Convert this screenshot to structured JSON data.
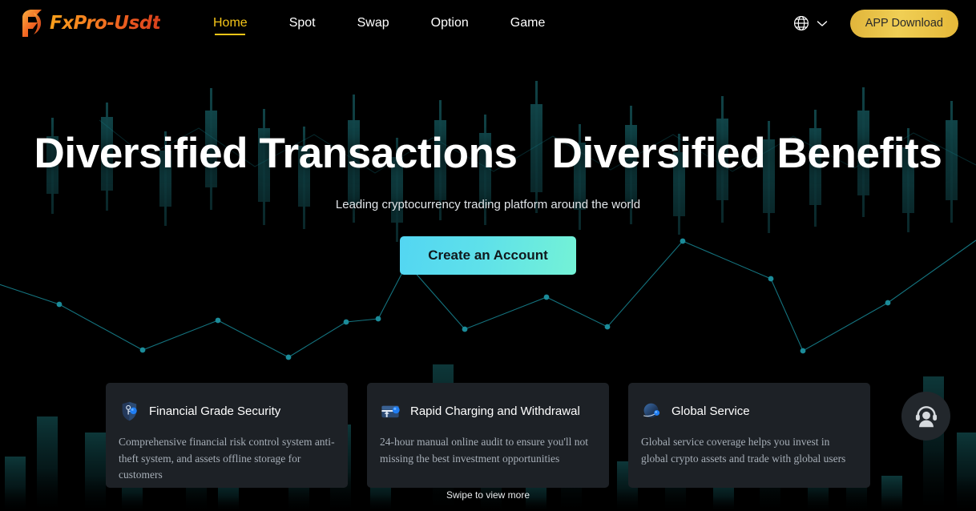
{
  "brand": {
    "logo_text": "FxPro-Usdt",
    "logo_icon": "flame-f-logo-icon"
  },
  "header": {
    "nav": [
      {
        "label": "Home",
        "active": true
      },
      {
        "label": "Spot",
        "active": false
      },
      {
        "label": "Swap",
        "active": false
      },
      {
        "label": "Option",
        "active": false
      },
      {
        "label": "Game",
        "active": false
      }
    ],
    "language_icon": "globe-icon",
    "language_chevron_icon": "chevron-down-icon",
    "app_download_label": "APP Download"
  },
  "hero": {
    "title": "Diversified Transactions   Diversified Benefits",
    "subtitle": "Leading cryptocurrency trading platform around the world",
    "cta_label": "Create an Account"
  },
  "cards": [
    {
      "icon": "shield-key-icon",
      "title": "Financial Grade Security",
      "desc": "Comprehensive financial risk control system anti-theft system, and assets offline storage for customers"
    },
    {
      "icon": "wallet-arrow-up-icon",
      "title": "Rapid Charging and Withdrawal",
      "desc": "24-hour manual online audit to ensure you'll not missing the best investment opportunities"
    },
    {
      "icon": "planet-ring-icon",
      "title": "Global Service",
      "desc": "Global service coverage helps you invest in global crypto assets and trade with global users"
    }
  ],
  "swipe_hint": "Swipe to view more",
  "support": {
    "icon": "headset-support-icon"
  },
  "colors": {
    "page_bg": "#000000",
    "accent_yellow": "#f5c518",
    "brand_orange": "#f4801f",
    "cta_cyan": "#5ed8ef",
    "cta_mint": "#74f2d6",
    "card_bg": "#1d2126",
    "candle_teal": "#0f3a3e",
    "polyline_teal": "#167a86"
  }
}
